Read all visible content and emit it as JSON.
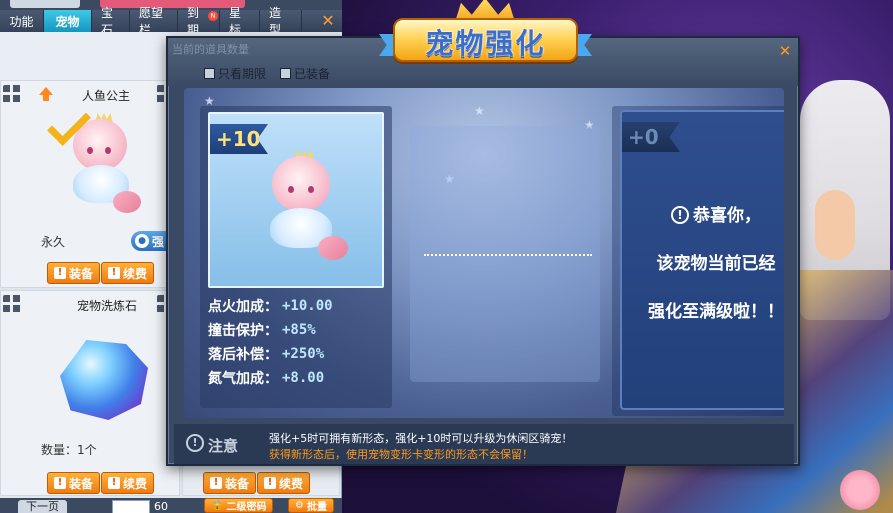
{
  "tabs": [
    {
      "label": "功能"
    },
    {
      "label": "宠物"
    },
    {
      "label": "宝石"
    },
    {
      "label": "愿望栏"
    },
    {
      "label": "到期",
      "badge": "N"
    },
    {
      "label": "星标"
    },
    {
      "label": "造型"
    }
  ],
  "inventory": {
    "item1": {
      "name": "人鱼公主",
      "duration": "永久",
      "strengthen_label": "强",
      "equip_label": "装备",
      "renew_label": "续费"
    },
    "item2": {
      "name": "宠物洗炼石",
      "quantity": "数量：1个",
      "equip_label": "装备",
      "renew_label": "续费"
    },
    "item3": {
      "equip_label": "装备",
      "renew_label": "续费"
    },
    "pager": {
      "prev_label": "下一页",
      "page_suffix": "60"
    },
    "bottom_btn1": "二级密码",
    "bottom_btn2": "批量"
  },
  "modal": {
    "title": "宠物强化",
    "ghost_header": "当前的道具数量",
    "filter_expiry": "只看期限",
    "filter_equipped": "已装备",
    "pet_level": "+10",
    "result_level": "+0",
    "stats": [
      {
        "key": "点火加成：",
        "value": "+10.00"
      },
      {
        "key": "撞击保护：",
        "value": "+85%"
      },
      {
        "key": "落后补偿：",
        "value": "+250%"
      },
      {
        "key": "氮气加成：",
        "value": "+8.00"
      }
    ],
    "result_lines": [
      "恭喜你，",
      "该宠物当前已经",
      "强化至满级啦！！"
    ],
    "notice_label": "注意",
    "notice_line1": "强化+5时可拥有新形态，强化+10时可以升级为休闲区骑宠！",
    "notice_line2": "获得新形态后，使用宠物变形卡变形的形态不会保留！"
  },
  "icons": {
    "close": "close-icon",
    "warning": "warning-icon",
    "grid": "grid-menu-icon",
    "up_arrow": "upgrade-arrow-icon",
    "check": "check-icon",
    "paw": "paw-icon"
  },
  "colors": {
    "accent_orange": "#f07a10",
    "tab_active": "#1596bf",
    "title_blue": "#3b6ec8",
    "stat_value": "#bfe6ff",
    "notice_orange": "#ff9a1a"
  }
}
